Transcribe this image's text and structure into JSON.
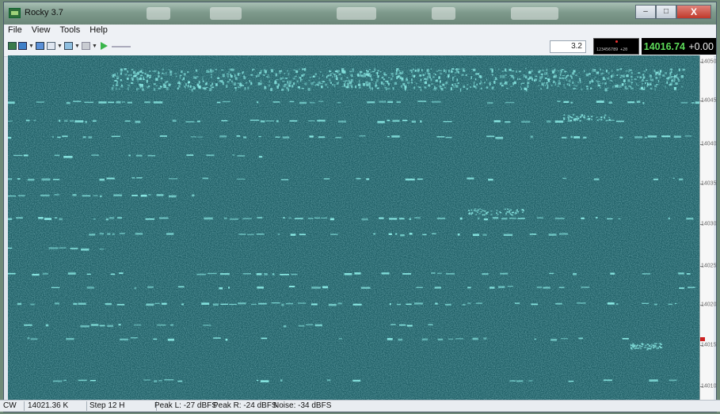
{
  "window": {
    "title": "Rocky 3.7",
    "close_label": "X",
    "minimize_label": "–",
    "maximize_label": "□"
  },
  "menu": [
    {
      "label": "File"
    },
    {
      "label": "View"
    },
    {
      "label": "Tools"
    },
    {
      "label": "Help"
    }
  ],
  "toolbar": {
    "zoom_value": "3.2",
    "scope_digits": "123456789 +20",
    "frequency": "14016.74",
    "offset": "+0.00"
  },
  "scale": {
    "labels": [
      "14050",
      "14045",
      "14040",
      "14035",
      "14030",
      "14025",
      "14020",
      "14015",
      "14010"
    ],
    "marker_freq": "14016.74"
  },
  "status": {
    "mode": "CW",
    "cursor_freq": "14021.36 K",
    "step": "Step 12 H",
    "peak_l": "Peak L: -27 dBFS",
    "peak_r": "Peak R: -24 dBFS",
    "noise": "Noise: -34 dBFS"
  },
  "colors": {
    "waterfall_bg": "#1f5f66",
    "signal": "#8ff0ea",
    "freq_green": "#5ddc5a"
  }
}
